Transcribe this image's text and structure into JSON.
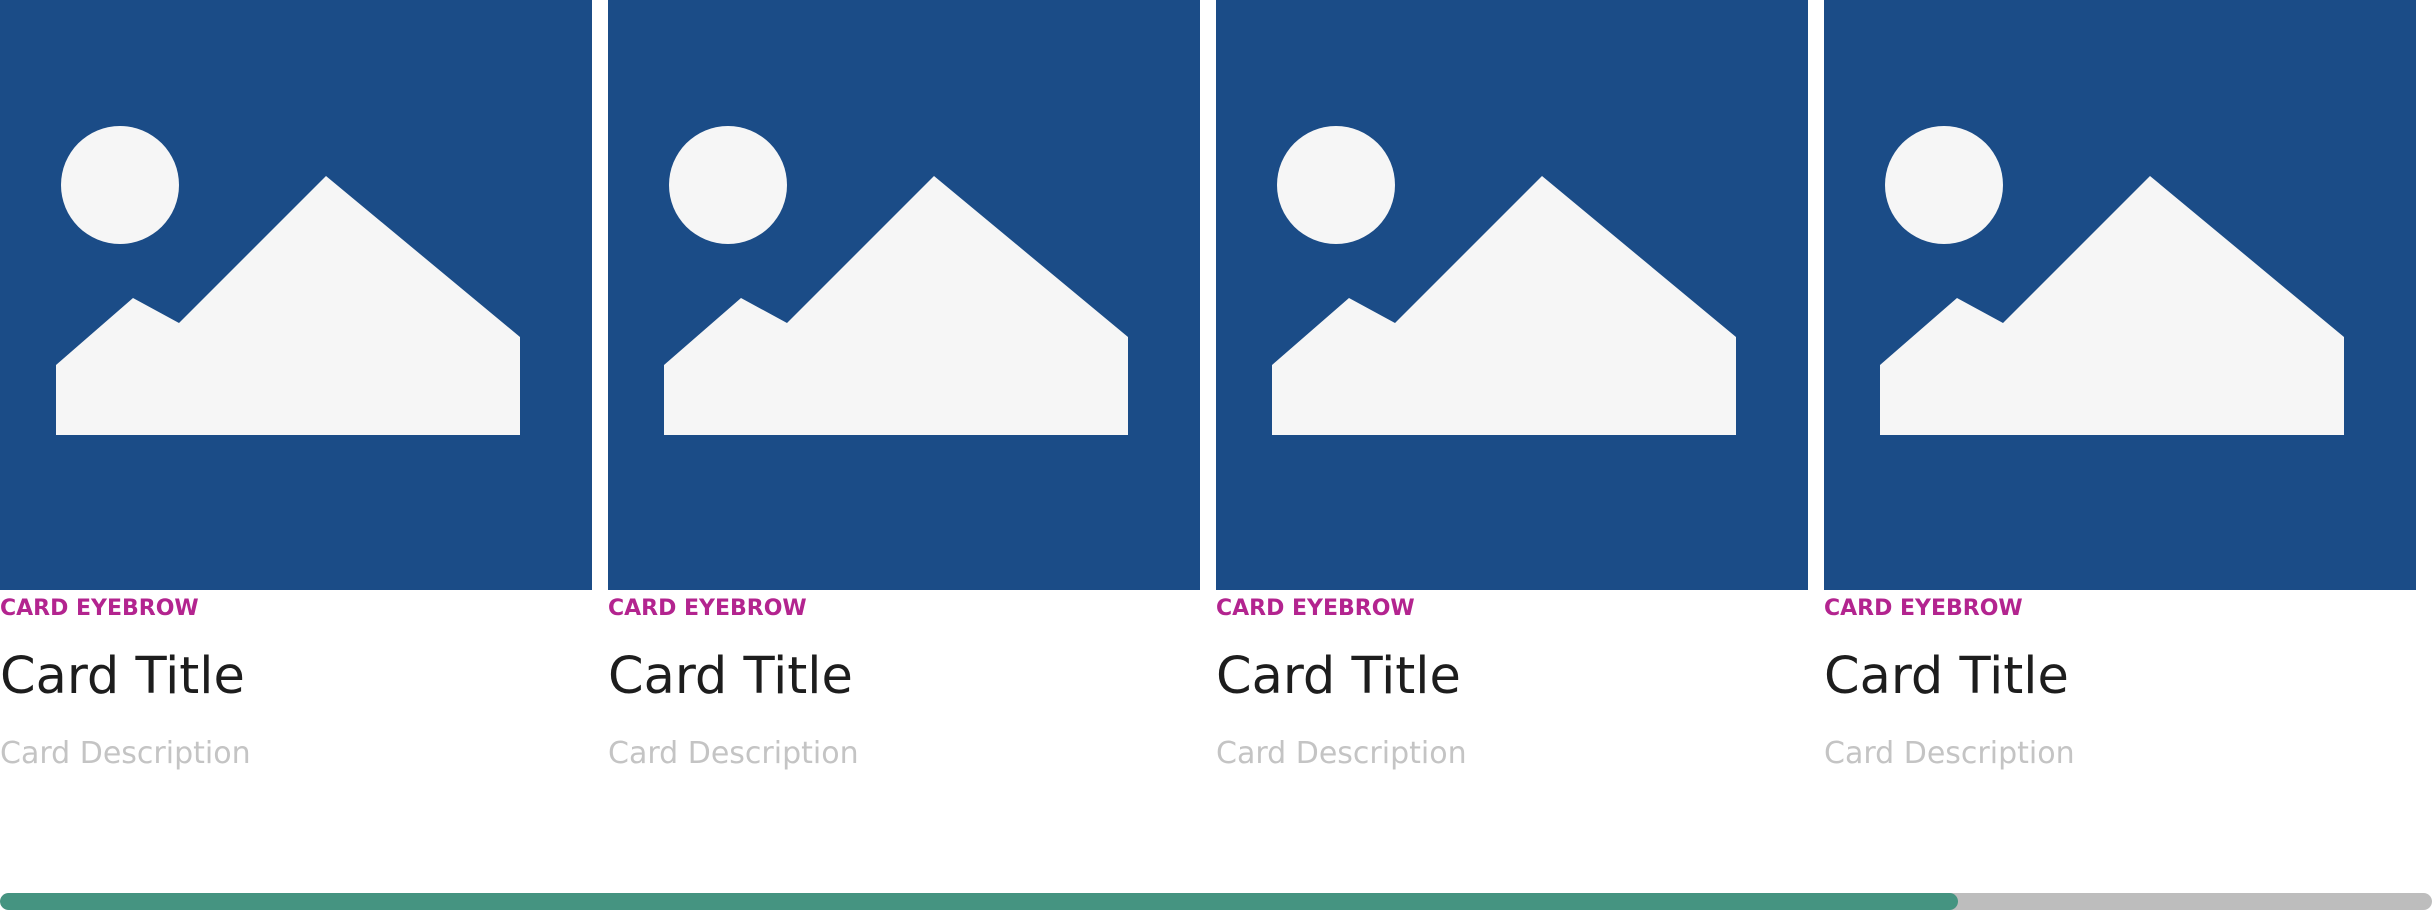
{
  "colors": {
    "media_background": "#1b4c87",
    "placeholder_shape": "#f6f6f6",
    "eyebrow": "#b3248f",
    "title": "#1d1d1d",
    "description": "#c4c4c4",
    "scroll_track": "#bdbdbd",
    "scroll_thumb": "#459481"
  },
  "cards": [
    {
      "image_icon": "image-placeholder-icon",
      "eyebrow": "CARD EYEBROW",
      "title": "Card Title",
      "description": "Card Description"
    },
    {
      "image_icon": "image-placeholder-icon",
      "eyebrow": "CARD EYEBROW",
      "title": "Card Title",
      "description": "Card Description"
    },
    {
      "image_icon": "image-placeholder-icon",
      "eyebrow": "CARD EYEBROW",
      "title": "Card Title",
      "description": "Card Description"
    },
    {
      "image_icon": "image-placeholder-icon",
      "eyebrow": "CARD EYEBROW",
      "title": "Card Title",
      "description": "Card Description"
    }
  ],
  "scrollbar": {
    "progress_fraction": 0.805
  }
}
